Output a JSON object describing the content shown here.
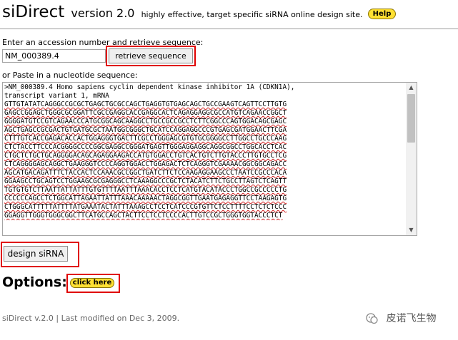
{
  "header": {
    "app_name": "siDirect",
    "version": "version 2.0",
    "tagline": "highly effective, target specific siRNA online design site.",
    "help_label": "Help"
  },
  "accession": {
    "label": "Enter an accession number and retrieve sequence:",
    "value": "NM_000389.4",
    "retrieve_label": "retrieve sequence"
  },
  "sequence": {
    "label": "or Paste in a nucleotide sequence:",
    "header_lines": [
      ">NM_000389.4 Homo sapiens cyclin dependent kinase inhibitor 1A (CDKN1A),",
      "transcript variant 1, mRNA"
    ],
    "lines": [
      "GTTGTATATCAGGGCCGCGCTGAGCTGCGCCAGCTGAGGTGTGAGCAGCTGCCGAAGTCAGTTCCTTGTG",
      "GAGCCGGAGCTGGGCGCGGATTCGCCGAGGCACCGAGGCACTCAGAGGAGGCGCCATGTCAGAACCGGCT",
      "GGGGATGTCCGTCAGAACCCATGCGGCAGCAAGGCCTGCCGCCGCCTCTTCGGCCCAGTGGACAGCGAGC",
      "AGCTGAGCCGCGACTGTGATGCGCTAATGGCGGGCTGCATCCAGGAGGCCCGTGAGCGATGGAACTTCGA",
      "CTTTGTCACCGAGACACCACTGGAGGGTGACTTCGCCTGGGAGCGTGTGCGGGGCCTTGGCCTGCCCAAG",
      "CTCTACCTTCCCACGGGGCCCCGGCGAGGCCGGGATGAGTTGGGAGGAGGCAGGCGGCCTGGCACCTCAC",
      "CTGCTCTGCTGCAGGGGACAGCAGAGGAAGACCATGTGGACCTGTCACTGTCTTGTACCCTTGTGCCTCG",
      "CTCAGGGGAGCAGGCTGAAGGGTCCCCAGGTGGACCTGGAGACTCTCAGGGTCGAAAACGGCGGCAGACC",
      "AGCATGACAGATTTCTACCACTCCAAACGCCGGCTGATCTTCTCCAAGAGGAAGCCCTAATCCGCCCACA",
      "GGAAGCCTGCAGTCCTGGAAGCGCGAGGGCCTCAAAGGCCCGCTCTACATCTTCTGCCTTAGTCTCAGTT",
      "TGTGTGTCTTAATTATTATTTGTGTTTTAATTTAAACACCTCCTCATGTACATACCCTGGCCGCCCCCTG",
      "CCCCCCAGCCTCTGGCATTAGAATTATTTAAACAAAAACTAGGCGGTTGAATGAGAGGTTCCTAAGAGTG",
      "CTGGGCATTTTTATTTTATGAAATACTATTTAAAGCCTCCTCATCCCGTGTTCTCCTTTTCCTCTCTCCC",
      "GGAGGTTGGGTGGGCGGCTTCATGCCAGCTACTTCCTCCTCCCCACTTGTCCGCTGGGTGGTACCCTCT"
    ]
  },
  "design": {
    "label": "design siRNA"
  },
  "options": {
    "label": "Options:",
    "click_label": "click here"
  },
  "footer": {
    "text": "siDirect v.2.0 | Last modified on Dec 3, 2009."
  },
  "watermark": {
    "text": "皮诺飞生物"
  },
  "colors": {
    "highlight": "#e00000",
    "yellow_button": "#ffe033"
  }
}
